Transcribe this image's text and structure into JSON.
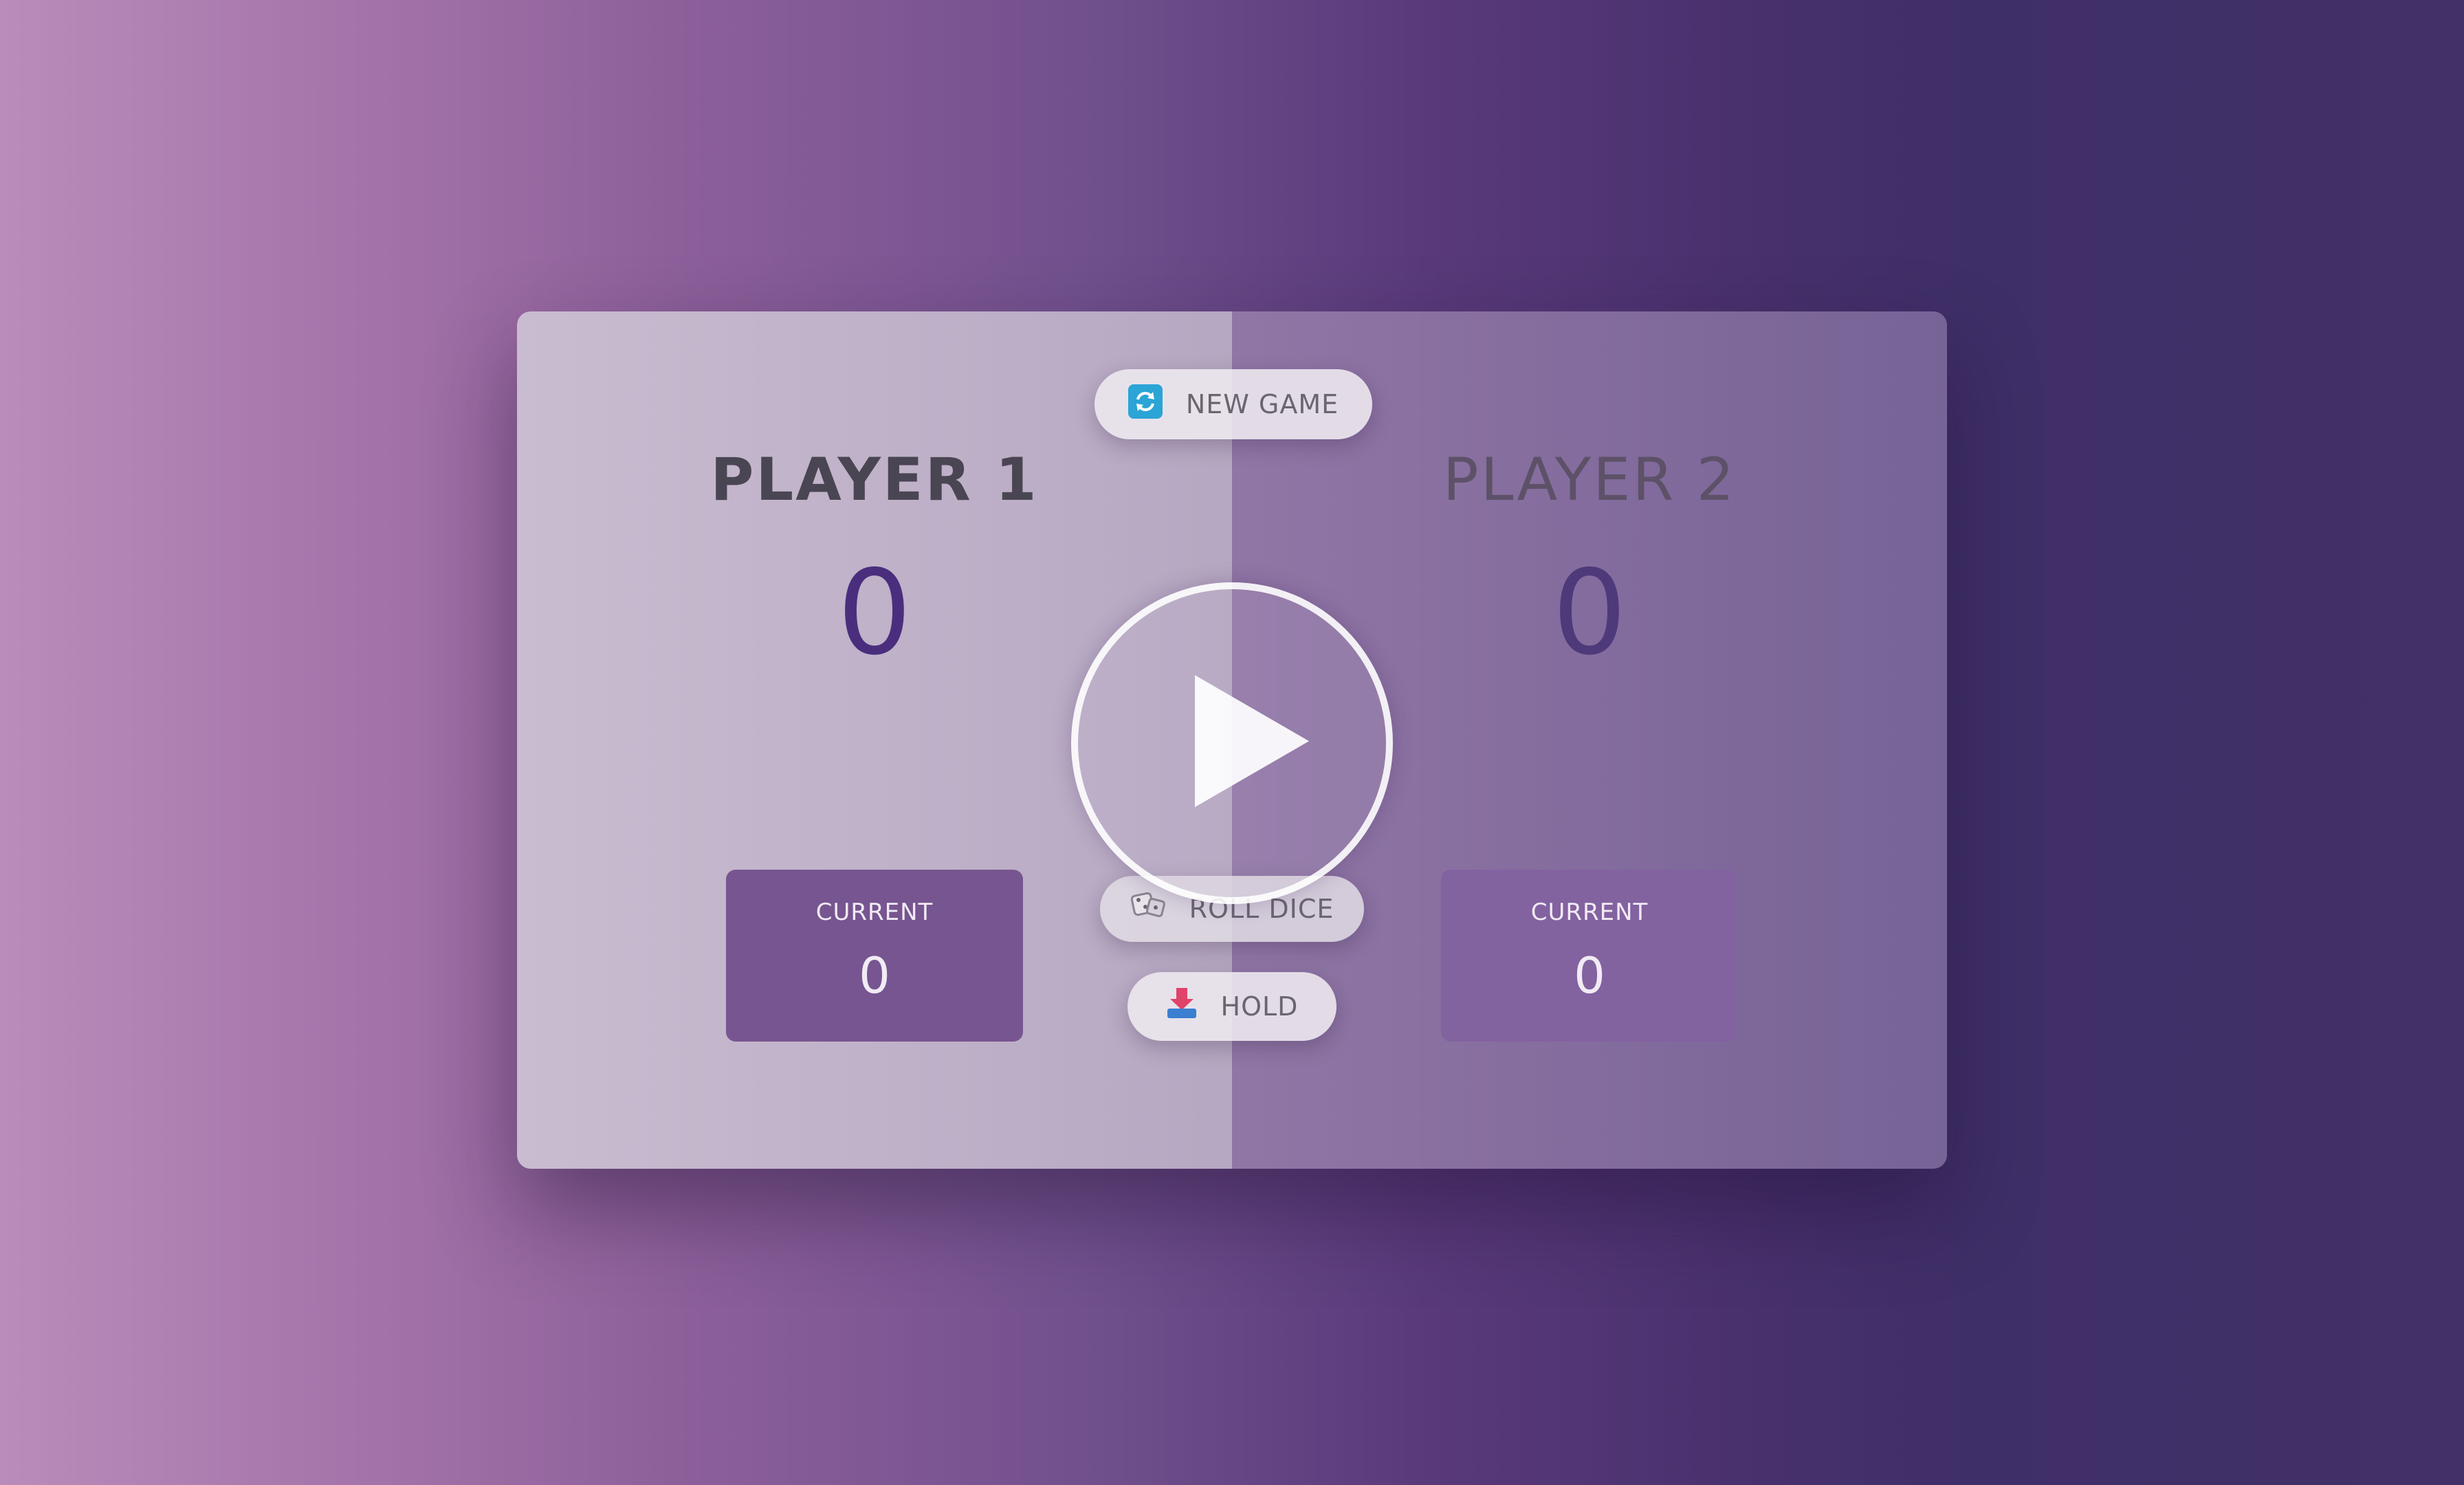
{
  "buttons": {
    "new_game": "NEW GAME",
    "roll_dice": "ROLL DICE",
    "hold": "HOLD"
  },
  "players": [
    {
      "name": "PLAYER 1",
      "score": "0",
      "current_label": "CURRENT",
      "current_score": "0",
      "active": true
    },
    {
      "name": "PLAYER 2",
      "score": "0",
      "current_label": "CURRENT",
      "current_score": "0",
      "active": false
    }
  ],
  "icons": {
    "new_game": "refresh-icon",
    "roll_dice": "dice-icon",
    "hold": "download-icon",
    "overlay": "play-icon"
  },
  "colors": {
    "accent": "#4a2e7d",
    "current_box_active": "#775590",
    "current_box_inactive": "#8362a0",
    "new_game_icon": "#2ba4d6"
  }
}
